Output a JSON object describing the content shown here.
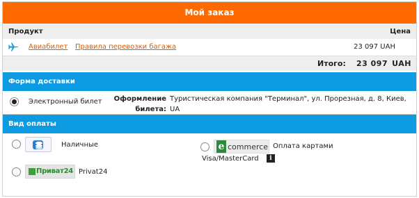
{
  "header": {
    "title": "Мой заказ"
  },
  "table": {
    "col_product": "Продукт",
    "col_price": "Цена",
    "product": {
      "icon": "airplane-icon",
      "ticket_link": "Авиабилет",
      "rules_link": "Правила перевозки багажа",
      "price": "23 097 UAH"
    },
    "total": {
      "label": "Итого:",
      "value": "23 097",
      "currency": "UAH"
    }
  },
  "delivery": {
    "section_title": "Форма доставки",
    "option_label": "Электронный билет",
    "option_selected": true,
    "issuance_label": "Оформление билета:",
    "issuance_value": "Туристическая компания \"Терминал\", ул. Прорезная, д. 8, Киев, UA"
  },
  "payment": {
    "section_title": "Вид оплаты",
    "cash": {
      "label": "Наличные",
      "selected": false
    },
    "ecommerce": {
      "logo_e": "e",
      "logo_text": "commerce",
      "label_line1": "Оплата картами",
      "label_line2": "Visa/MasterCard",
      "info": "i",
      "selected": false
    },
    "privat24": {
      "logo_text": "Приват24",
      "label": "Privat24",
      "selected": false
    }
  },
  "colors": {
    "header_orange": "#ff6a00",
    "section_blue": "#0c9be0",
    "link_orange": "#e05a00",
    "privat_green": "#3aa23a"
  }
}
